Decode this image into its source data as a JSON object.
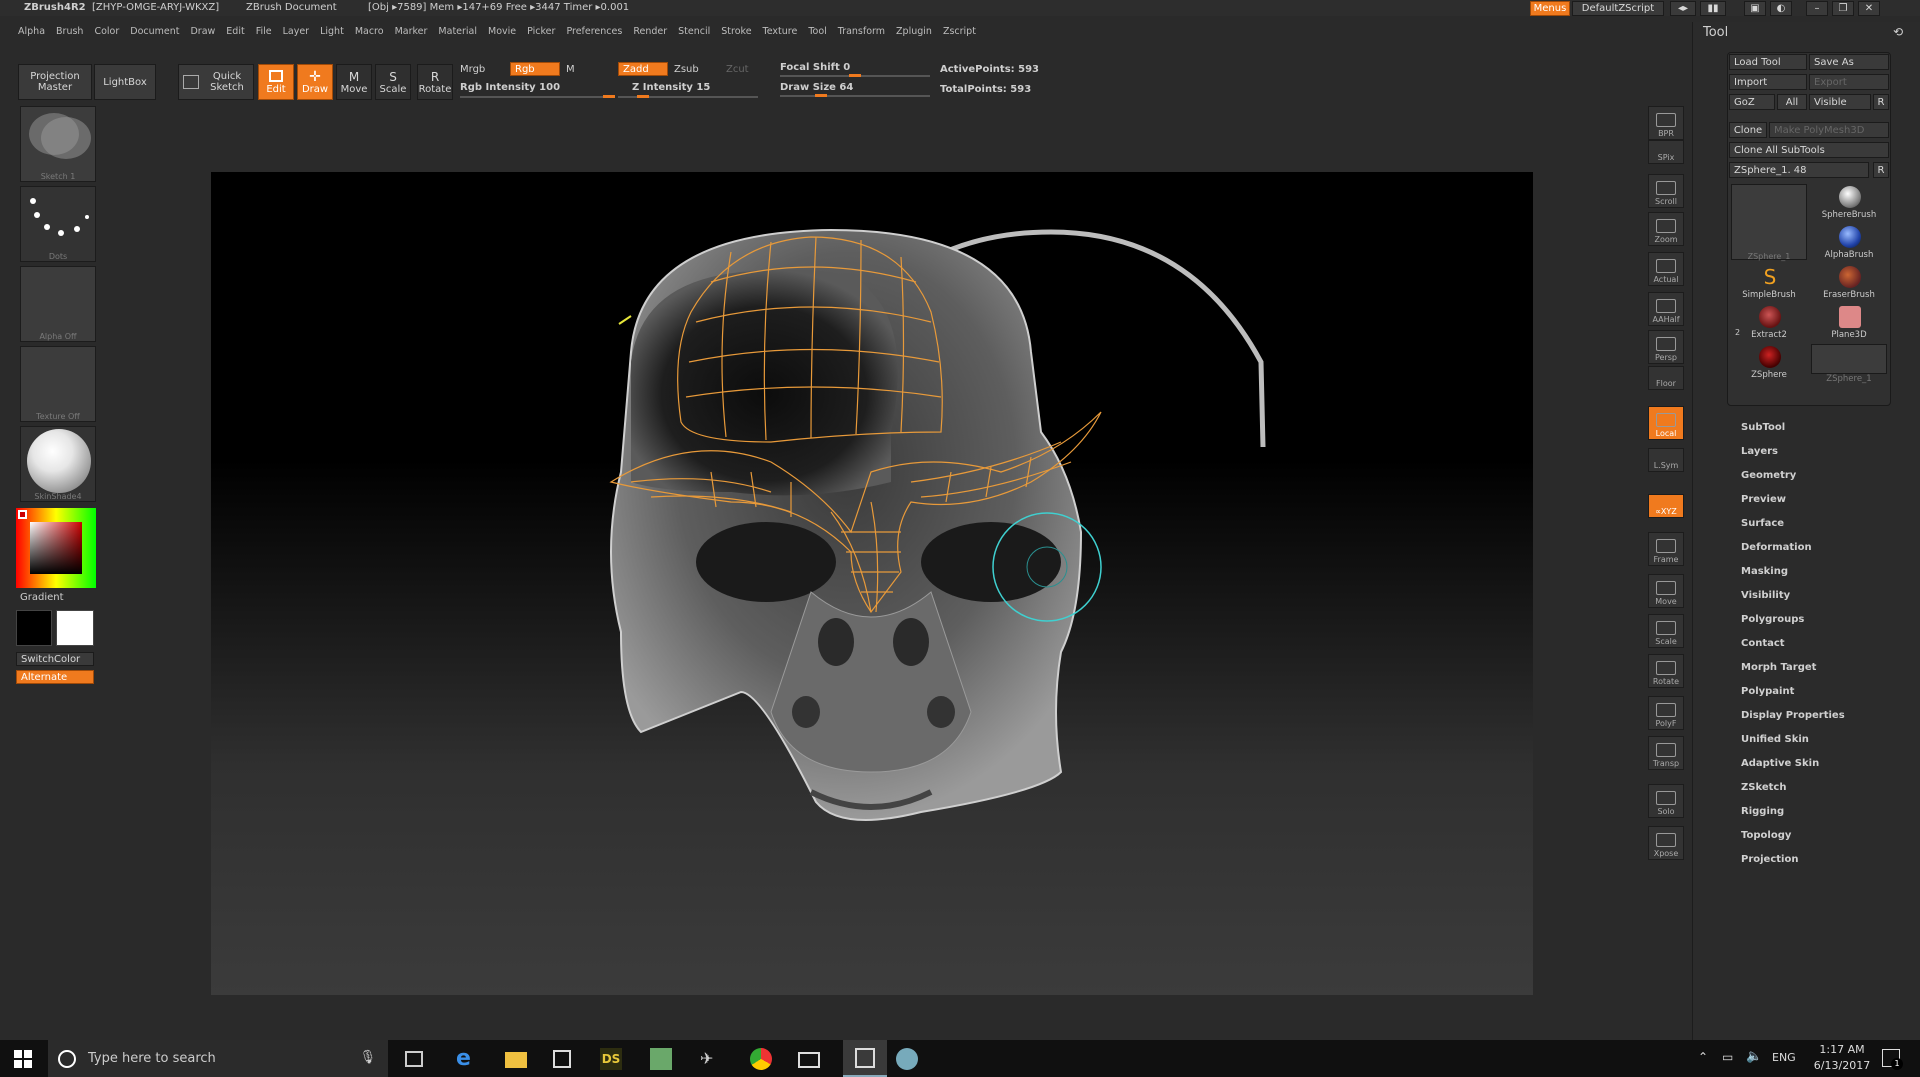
{
  "title": {
    "app": "ZBrush4R2",
    "serial": "[ZHYP-OMGE-ARYJ-WKXZ]",
    "document": "ZBrush Document",
    "stats": "[Obj ▸7589] Mem ▸147+69 Free ▸3447 Timer ▸0.001",
    "menus_button": "Menus",
    "script_button": "DefaultZScript"
  },
  "menu": [
    "Alpha",
    "Brush",
    "Color",
    "Document",
    "Draw",
    "Edit",
    "File",
    "Layer",
    "Light",
    "Macro",
    "Marker",
    "Material",
    "Movie",
    "Picker",
    "Preferences",
    "Render",
    "Stencil",
    "Stroke",
    "Texture",
    "Tool",
    "Transform",
    "Zplugin",
    "Zscript"
  ],
  "toolbar": {
    "projection_master": "Projection Master",
    "lightbox": "LightBox",
    "quick_sketch": "Quick Sketch",
    "edit": "Edit",
    "draw": "Draw",
    "move": "Move",
    "scale": "Scale",
    "rotate": "Rotate",
    "mrgb": "Mrgb",
    "rgb": "Rgb",
    "m": "M",
    "rgb_intensity": "Rgb Intensity 100",
    "zadd": "Zadd",
    "zsub": "Zsub",
    "zcut": "Zcut",
    "z_intensity": "Z Intensity 15",
    "focal_shift": "Focal Shift 0",
    "draw_size": "Draw Size 64",
    "active_points": "ActivePoints: 593",
    "total_points": "TotalPoints: 593",
    "rgb_intensity_value": 100,
    "z_intensity_value": 15,
    "focal_shift_value": 0,
    "draw_size_value": 64
  },
  "left_shelf": {
    "brush_label": "Sketch 1",
    "stroke_label": "Dots",
    "alpha_label": "Alpha Off",
    "texture_label": "Texture Off",
    "material_label": "SkinShade4",
    "gradient_label": "Gradient",
    "switch_color": "SwitchColor",
    "alternate": "Alternate"
  },
  "right_shelf": [
    {
      "id": "bpr",
      "label": "BPR"
    },
    {
      "id": "spix",
      "label": "SPix"
    },
    {
      "id": "scroll",
      "label": "Scroll"
    },
    {
      "id": "zoom",
      "label": "Zoom"
    },
    {
      "id": "actual",
      "label": "Actual"
    },
    {
      "id": "aahalf",
      "label": "AAHalf"
    },
    {
      "id": "persp",
      "label": "Persp"
    },
    {
      "id": "floor",
      "label": "Floor"
    },
    {
      "id": "local",
      "label": "Local"
    },
    {
      "id": "lsym",
      "label": "L.Sym"
    },
    {
      "id": "xyz",
      "label": "∝XYZ"
    },
    {
      "id": "frame",
      "label": "Frame"
    },
    {
      "id": "move",
      "label": "Move"
    },
    {
      "id": "scale",
      "label": "Scale"
    },
    {
      "id": "rotate",
      "label": "Rotate"
    },
    {
      "id": "polyf",
      "label": "PolyF"
    },
    {
      "id": "transp",
      "label": "Transp"
    },
    {
      "id": "solo",
      "label": "Solo"
    },
    {
      "id": "xpose",
      "label": "Xpose"
    }
  ],
  "tool_panel": {
    "title": "Tool",
    "load_tool": "Load Tool",
    "save_as": "Save As",
    "import": "Import",
    "export": "Export",
    "goz": "GoZ",
    "all": "All",
    "visible": "Visible",
    "r": "R",
    "clone": "Clone",
    "make_polymesh": "Make PolyMesh3D",
    "clone_all": "Clone All SubTools",
    "current_tool": "ZSphere_1. 48",
    "current_tool_value": 48,
    "tools": [
      {
        "label": "SphereBrush"
      },
      {
        "label": "AlphaBrush"
      },
      {
        "label": "SimpleBrush"
      },
      {
        "label": "EraserBrush"
      },
      {
        "label": "Extract2"
      },
      {
        "label": "Plane3D"
      },
      {
        "label": "ZSphere"
      },
      {
        "label": "ZSphere_1"
      }
    ],
    "big_thumb_label": "ZSphere_1",
    "extract_badge": "2",
    "subpalettes": [
      "SubTool",
      "Layers",
      "Geometry",
      "Preview",
      "Surface",
      "Deformation",
      "Masking",
      "Visibility",
      "Polygroups",
      "Contact",
      "Morph Target",
      "Polypaint",
      "Display Properties",
      "Unified Skin",
      "Adaptive Skin",
      "ZSketch",
      "Rigging",
      "Topology",
      "Projection"
    ]
  },
  "taskbar": {
    "search_placeholder": "Type here to search",
    "lang": "ENG",
    "time": "1:17 AM",
    "date": "6/13/2017",
    "ds_label": "DS",
    "notif_count": "1"
  },
  "colors": {
    "accent": "#f07a1e",
    "wire": "#e89a3a",
    "cursor": "#3fd0d0",
    "panel": "#2b2b2b"
  }
}
